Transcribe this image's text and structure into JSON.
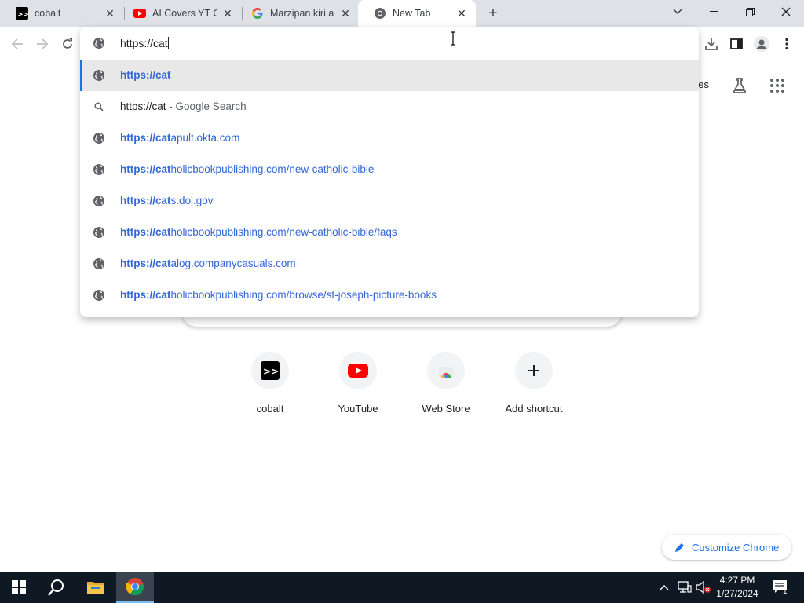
{
  "tabs": [
    {
      "title": "cobalt",
      "icon": "cobalt-icon"
    },
    {
      "title": "AI Covers YT Of",
      "icon": "youtube-icon"
    },
    {
      "title": "Marzipan kiri an",
      "icon": "google-icon"
    },
    {
      "title": "New Tab",
      "icon": "chrome-icon",
      "active": true
    }
  ],
  "omnibox": {
    "value": "https://cat",
    "suggestions": [
      {
        "bold": "https://cat",
        "rest": "",
        "type": "url",
        "selected": true
      },
      {
        "query": "https://cat",
        "suffix": " - Google Search",
        "type": "search"
      },
      {
        "bold": "https://cat",
        "rest": "apult.okta.com",
        "type": "url"
      },
      {
        "bold": "https://cat",
        "rest": "holicbookpublishing.com/new-catholic-bible",
        "type": "url"
      },
      {
        "bold": "https://cat",
        "rest": "s.doj.gov",
        "type": "url"
      },
      {
        "bold": "https://cat",
        "rest": "holicbookpublishing.com/new-catholic-bible/faqs",
        "type": "url"
      },
      {
        "bold": "https://cat",
        "rest": "alog.companycasuals.com",
        "type": "url"
      },
      {
        "bold": "https://cat",
        "rest": "holicbookpublishing.com/browse/st-joseph-picture-books",
        "type": "url"
      }
    ]
  },
  "ntp": {
    "images_partial": "ges",
    "shortcuts": [
      {
        "label": "cobalt",
        "icon": "cobalt-icon"
      },
      {
        "label": "YouTube",
        "icon": "youtube-icon"
      },
      {
        "label": "Web Store",
        "icon": "webstore-icon"
      },
      {
        "label": "Add shortcut",
        "icon": "plus-icon"
      }
    ],
    "customize_label": "Customize Chrome"
  },
  "taskbar": {
    "time": "4:27 PM",
    "date": "1/27/2024",
    "notification_count": "1"
  },
  "colors": {
    "accent": "#1a73e8",
    "url": "#3367d6",
    "tabstrip": "#dee1e6",
    "taskbar": "#0f1923"
  }
}
